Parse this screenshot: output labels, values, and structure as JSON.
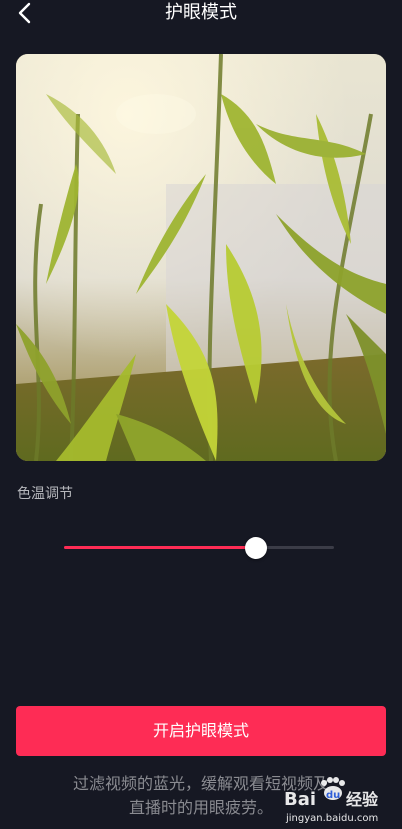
{
  "header": {
    "back_icon": "chevron-left-icon",
    "title": "护眼模式"
  },
  "preview": {
    "description_icon": "bamboo-leaves-photo"
  },
  "color_temperature": {
    "label": "色温调节",
    "value_fraction": 0.71,
    "accent_color": "#fe2c55",
    "track_color": "#3b3c47"
  },
  "actions": {
    "enable_label": "开启护眼模式"
  },
  "description": {
    "line1": "过滤视频的蓝光，缓解观看短视频及",
    "line2": "直播时的用眼疲劳。"
  },
  "watermark": {
    "text": "Bai du 经验",
    "url": "jingyan.baidu.com"
  },
  "colors": {
    "background": "#161823",
    "primary": "#fe2c55"
  }
}
